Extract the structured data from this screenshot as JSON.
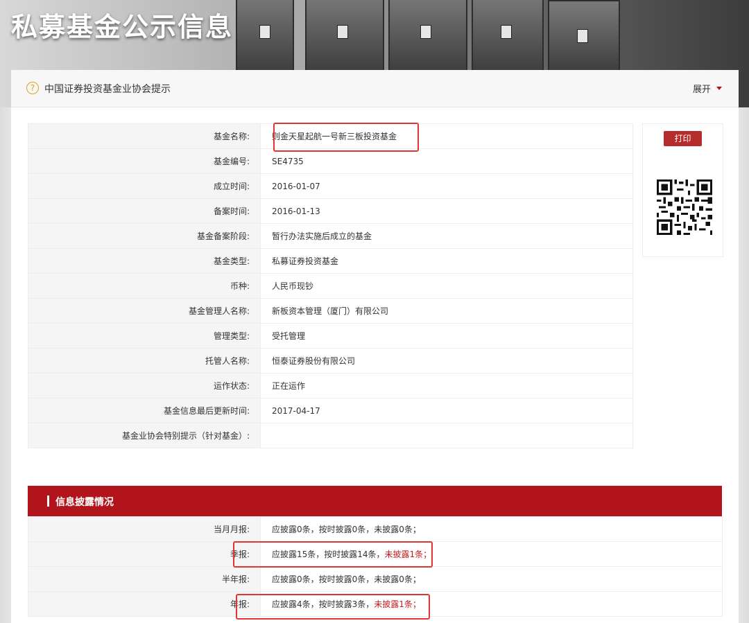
{
  "header": {
    "title": "私募基金公示信息"
  },
  "notice": {
    "text": "中国证券投资基金业协会提示",
    "expand_label": "展开"
  },
  "print_label": "打印",
  "fund_info": [
    {
      "label": "基金名称:",
      "value": "则金天星起航一号新三板投资基金"
    },
    {
      "label": "基金编号:",
      "value": "SE4735"
    },
    {
      "label": "成立时间:",
      "value": "2016-01-07"
    },
    {
      "label": "备案时间:",
      "value": "2016-01-13"
    },
    {
      "label": "基金备案阶段:",
      "value": "暂行办法实施后成立的基金"
    },
    {
      "label": "基金类型:",
      "value": "私募证券投资基金"
    },
    {
      "label": "币种:",
      "value": "人民币现钞"
    },
    {
      "label": "基金管理人名称:",
      "value": "新板资本管理（厦门）有限公司"
    },
    {
      "label": "管理类型:",
      "value": "受托管理"
    },
    {
      "label": "托管人名称:",
      "value": "恒泰证券股份有限公司"
    },
    {
      "label": "运作状态:",
      "value": "正在运作"
    },
    {
      "label": "基金信息最后更新时间:",
      "value": "2017-04-17"
    },
    {
      "label": "基金业协会特别提示（针对基金）:",
      "value": ""
    }
  ],
  "disclosure": {
    "title": "信息披露情况",
    "rows": [
      {
        "label": "当月月报:",
        "value": "应披露0条，按时披露0条，未披露0条；",
        "missing": ""
      },
      {
        "label": "季报:",
        "value": "应披露15条，按时披露14条，",
        "missing": "未披露1条；"
      },
      {
        "label": "半年报:",
        "value": "应披露0条，按时披露0条，未披露0条；",
        "missing": ""
      },
      {
        "label": "年报:",
        "value": "应披露4条，按时披露3条，",
        "missing": "未披露1条；"
      }
    ]
  }
}
